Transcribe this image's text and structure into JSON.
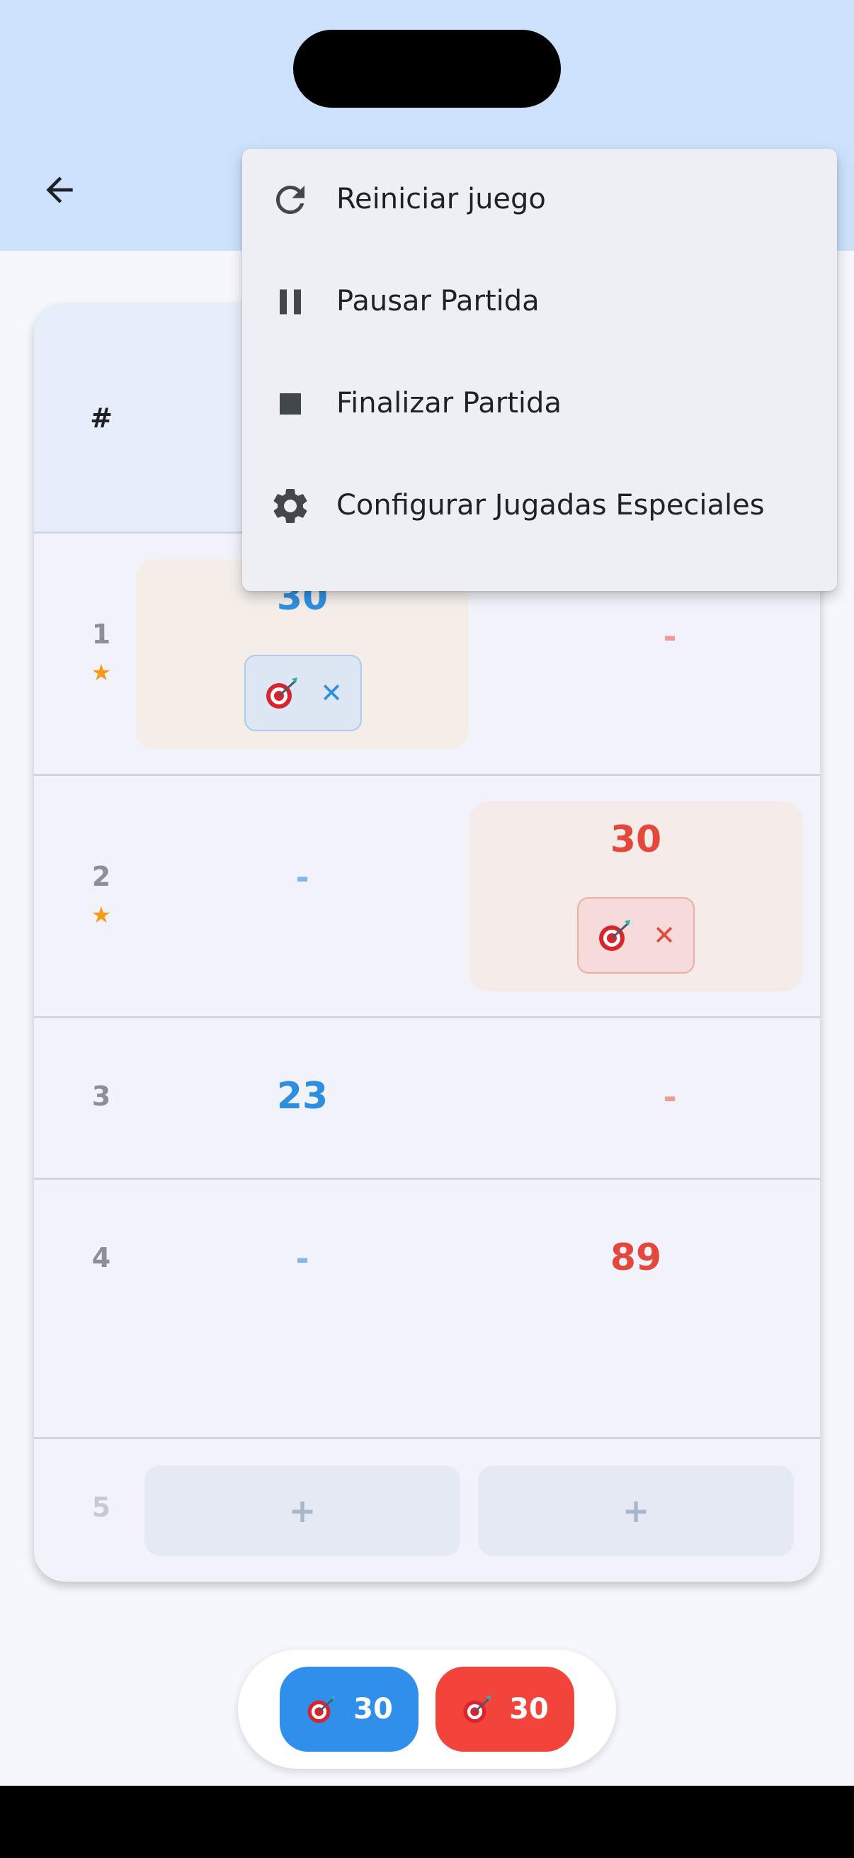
{
  "header": {
    "back_icon": "arrow-left-icon"
  },
  "table": {
    "hash_label": "#",
    "rows": [
      {
        "number": "1",
        "star": "★",
        "blue": "30",
        "red": "-"
      },
      {
        "number": "2",
        "star": "★",
        "blue": "-",
        "red": "30"
      },
      {
        "number": "3",
        "blue": "23",
        "red": "-"
      },
      {
        "number": "4",
        "blue": "-",
        "red": "89"
      },
      {
        "number": "5",
        "blue_add": "+",
        "red_add": "+"
      }
    ],
    "chip_close": "✕",
    "chip_icon": "dart-target-icon"
  },
  "menu": {
    "items": [
      {
        "label": "Reiniciar juego",
        "icon": "refresh-icon"
      },
      {
        "label": "Pausar Partida",
        "icon": "pause-icon"
      },
      {
        "label": "Finalizar Partida",
        "icon": "stop-icon"
      },
      {
        "label": "Configurar Jugadas Especiales",
        "icon": "gear-icon"
      }
    ]
  },
  "bottom": {
    "blue_value": "30",
    "red_value": "30"
  },
  "colors": {
    "blue": "#2f8fea",
    "red": "#f2443a",
    "appbar": "#cde1fd",
    "star": "#f59a1b"
  }
}
